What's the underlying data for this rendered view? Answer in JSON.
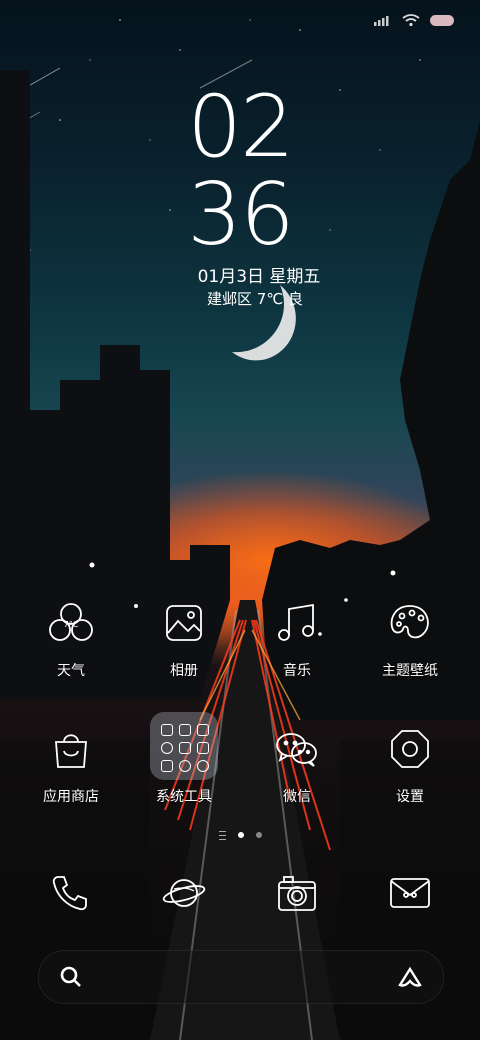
{
  "clock": {
    "hour": "02",
    "minute": "36"
  },
  "date": {
    "text": "01月3日 星期五"
  },
  "weather": {
    "text": "建邺区 7℃ 良"
  },
  "apps": [
    {
      "label": "天气",
      "icon": "weather-icon"
    },
    {
      "label": "相册",
      "icon": "gallery-icon"
    },
    {
      "label": "音乐",
      "icon": "music-icon"
    },
    {
      "label": "主题壁纸",
      "icon": "palette-icon"
    },
    {
      "label": "应用商店",
      "icon": "shopping-bag-icon"
    },
    {
      "label": "系统工具",
      "icon": "folder-icon"
    },
    {
      "label": "微信",
      "icon": "wechat-icon"
    },
    {
      "label": "设置",
      "icon": "settings-icon"
    }
  ],
  "weather_icon_text": "7°C",
  "dock": [
    {
      "icon": "phone-icon"
    },
    {
      "icon": "browser-planet-icon"
    },
    {
      "icon": "camera-icon"
    },
    {
      "icon": "messages-icon"
    }
  ],
  "page_indicator": {
    "pages": 2,
    "current": 1
  },
  "colors": {
    "accent_sunset": "#ff6a1a",
    "text": "#ffffff",
    "sky_top": "#05121c"
  }
}
